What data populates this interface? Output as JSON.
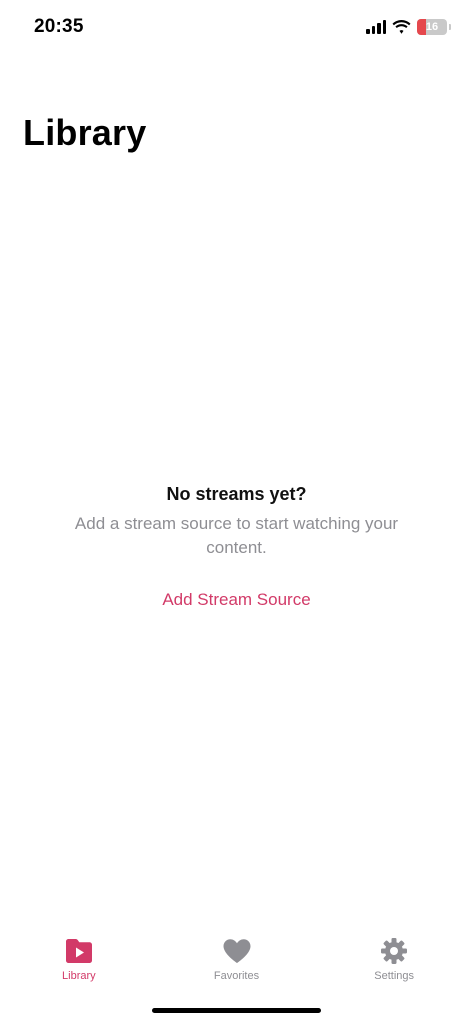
{
  "status_bar": {
    "time": "20:35",
    "battery_level": "16",
    "battery_fraction": 0.16
  },
  "page": {
    "title": "Library"
  },
  "empty_state": {
    "title": "No streams yet?",
    "message": "Add a stream source to start watching your content.",
    "action_label": "Add Stream Source"
  },
  "tab_bar": {
    "tabs": [
      {
        "label": "Library",
        "icon": "folder-play-icon",
        "active": true
      },
      {
        "label": "Favorites",
        "icon": "heart-icon",
        "active": false
      },
      {
        "label": "Settings",
        "icon": "gear-icon",
        "active": false
      }
    ]
  },
  "colors": {
    "accent": "#d23a68",
    "inactive": "#8e8e93",
    "battery_low": "#e5484d"
  }
}
